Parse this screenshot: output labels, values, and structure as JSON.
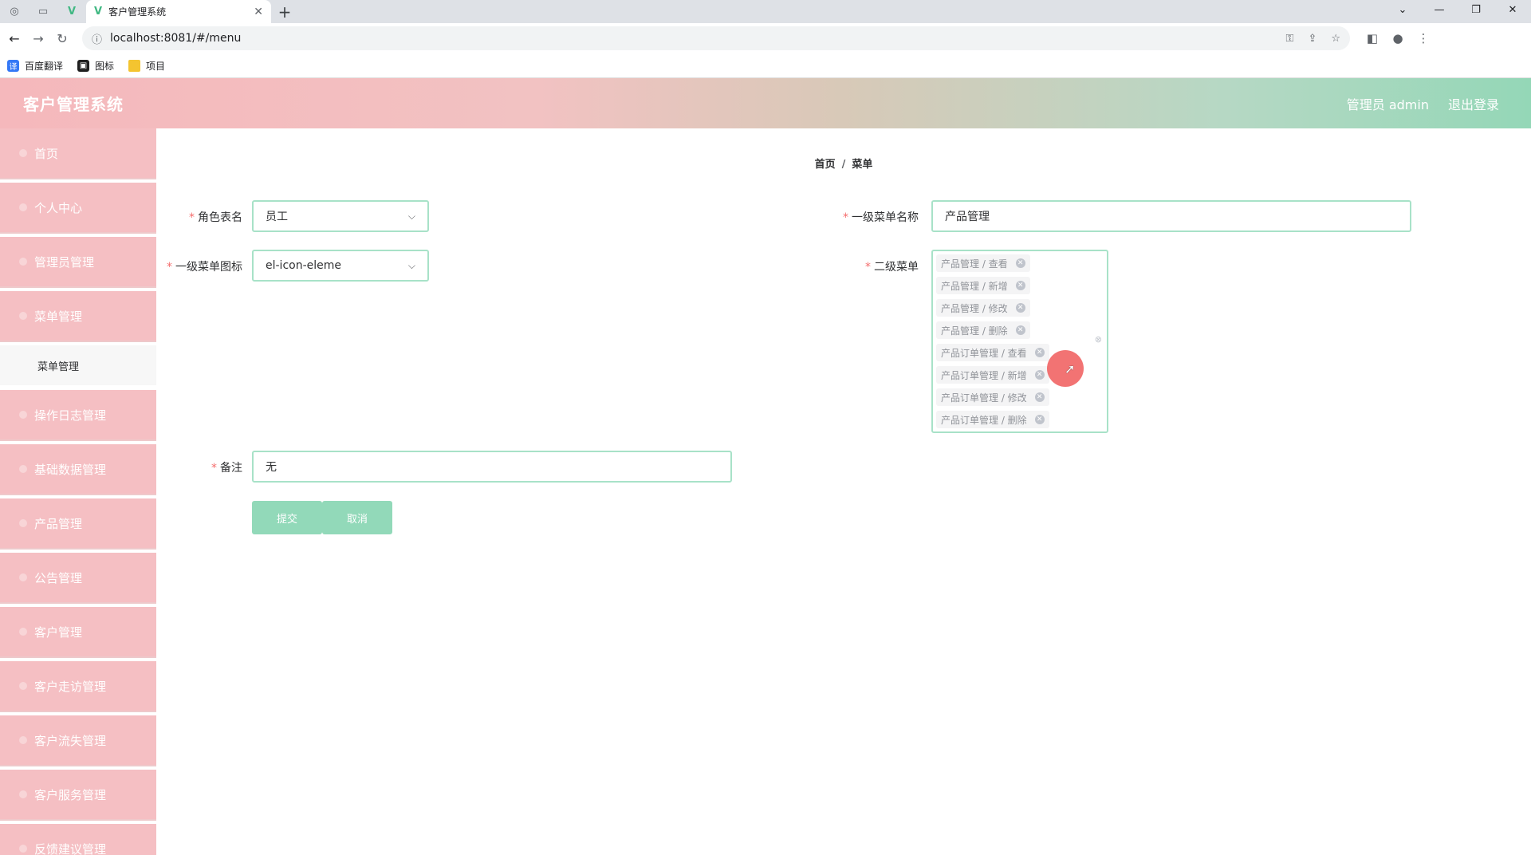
{
  "browser": {
    "tab_title": "客户管理系统",
    "url": "localhost:8081/#/menu",
    "bookmarks": [
      {
        "label": "百度翻译",
        "icon": "translate-icon"
      },
      {
        "label": "图标",
        "icon": "image-icon"
      },
      {
        "label": "项目",
        "icon": "folder-icon"
      }
    ]
  },
  "header": {
    "title": "客户管理系统",
    "user": "管理员 admin",
    "logout": "退出登录"
  },
  "sidebar": {
    "items": [
      {
        "label": "首页"
      },
      {
        "label": "个人中心"
      },
      {
        "label": "管理员管理"
      },
      {
        "label": "菜单管理"
      },
      {
        "label": "操作日志管理"
      },
      {
        "label": "基础数据管理"
      },
      {
        "label": "产品管理"
      },
      {
        "label": "公告管理"
      },
      {
        "label": "客户管理"
      },
      {
        "label": "客户走访管理"
      },
      {
        "label": "客户流失管理"
      },
      {
        "label": "客户服务管理"
      },
      {
        "label": "反馈建议管理"
      }
    ],
    "submenu": {
      "label": "菜单管理"
    }
  },
  "breadcrumb": {
    "home": "首页",
    "current": "菜单"
  },
  "form": {
    "role": {
      "label": "角色表名",
      "value": "员工"
    },
    "menu_name": {
      "label": "一级菜单名称",
      "value": "产品管理"
    },
    "menu_icon": {
      "label": "一级菜单图标",
      "value": "el-icon-eleme"
    },
    "submenus": {
      "label": "二级菜单",
      "tags": [
        "产品管理 / 查看",
        "产品管理 / 新增",
        "产品管理 / 修改",
        "产品管理 / 删除",
        "产品订单管理 / 查看",
        "产品订单管理 / 新增",
        "产品订单管理 / 修改",
        "产品订单管理 / 删除"
      ]
    },
    "remark": {
      "label": "备注",
      "value": "无"
    },
    "submit": "提交",
    "cancel": "取消"
  },
  "colors": {
    "accent_green": "#92d9b9",
    "sidebar_pink": "#f5bfc3",
    "required_red": "#f56c6c"
  }
}
